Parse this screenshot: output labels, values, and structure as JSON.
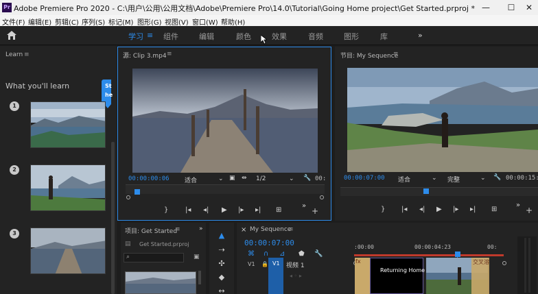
{
  "window": {
    "title": "Adobe Premiere Pro 2020 - C:\\用户\\公用\\公用文档\\Adobe\\Premiere Pro\\14.0\\Tutorial\\Going Home project\\Get Started.prproj *",
    "logo_text": "Pr",
    "minimize": "—",
    "maximize": "☐",
    "close": "✕"
  },
  "menu": [
    "文件(F)",
    "编辑(E)",
    "剪辑(C)",
    "序列(S)",
    "标记(M)",
    "图形(G)",
    "视图(V)",
    "窗口(W)",
    "帮助(H)"
  ],
  "workspace": {
    "home_icon": "home-icon",
    "tabs": [
      "学习",
      "组件",
      "编辑",
      "颜色",
      "效果",
      "音频",
      "图形",
      "库"
    ],
    "active_tab": "学习",
    "menu_glyph": "≡",
    "more": "»"
  },
  "learn": {
    "panel_title": "Learn",
    "menu_glyph": "≡",
    "heading": "What you'll learn",
    "tooltip_partial": [
      "St",
      "he"
    ],
    "steps": [
      "1",
      "2",
      "3"
    ]
  },
  "source": {
    "panel_title": "源: Clip 3.mp4",
    "menu_glyph": "≡",
    "timecode": "00:00:00:06",
    "fit": "适合",
    "resolution": "1/2",
    "timecode_right": "00:"
  },
  "program": {
    "panel_title": "节目: My Sequence",
    "menu_glyph": "≡",
    "timecode": "00:00:07:00",
    "fit": "适合",
    "quality": "完整",
    "timecode_right": "00:00:15:2"
  },
  "project": {
    "panel_title": "项目: Get Started",
    "menu_glyph": "≡",
    "more": "»",
    "file_name": "Get Started.prproj"
  },
  "timeline": {
    "panel_title": "My Sequence",
    "menu_glyph": "≡",
    "close": "×",
    "timecode": "00:00:07:00",
    "ruler_labels": [
      ":00:00",
      "00:00:04:23",
      "00:"
    ],
    "track_v1_left": "V1",
    "track_v1_right": "V1",
    "track_name": "视频 1",
    "title_clip_text": "Returning Home",
    "fx_badge": "fx",
    "fx_clip_text": "交叉溶"
  },
  "colors": {
    "accent": "#2d8ceb",
    "panel_bg": "#232323",
    "app_bg": "#1d1d1d",
    "track_blue": "#1e5fa8",
    "clip_purple": "#8e77c8",
    "clip_gold": "#c9a96a",
    "transition_red": "#c0392b"
  }
}
